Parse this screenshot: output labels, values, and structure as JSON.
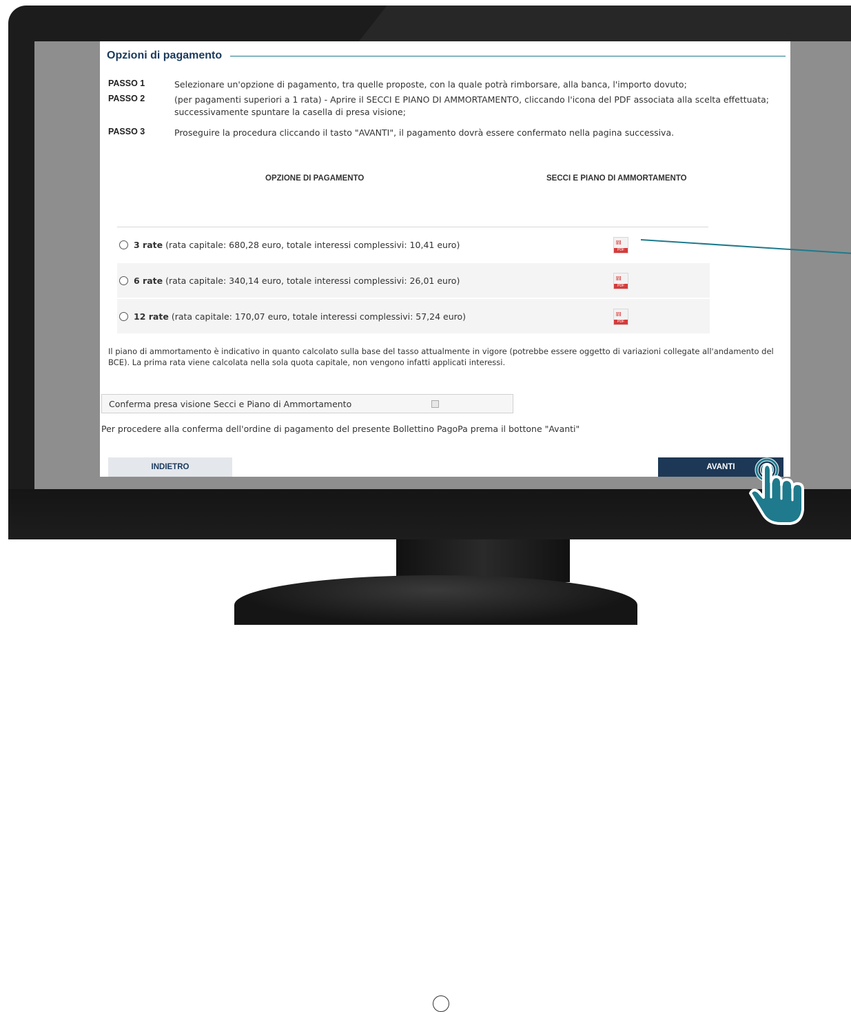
{
  "window": {
    "title": "Opzioni di pagamento"
  },
  "steps": [
    {
      "label": "PASSO 1",
      "text": "Selezionare un'opzione di pagamento, tra quelle proposte, con la quale potrà rimborsare, alla banca, l'importo dovuto;"
    },
    {
      "label": "PASSO 2",
      "text": "(per pagamenti superiori a 1 rata) - Aprire il SECCI E PIANO DI AMMORTAMENTO, cliccando l'icona del PDF associata alla scelta effettuata; successivamente spuntare la casella di presa visione;"
    },
    {
      "label": "PASSO 3",
      "text": "Proseguire la procedura cliccando il tasto \"AVANTI\", il pagamento dovrà essere confermato nella pagina successiva."
    }
  ],
  "table": {
    "col_option": "OPZIONE DI PAGAMENTO",
    "col_secci": "SECCI E PIANO DI AMMORTAMENTO",
    "pdf_tag": "PDF",
    "options": [
      {
        "rate": "3 rate",
        "detail": "(rata capitale: 680,28  euro, totale interessi complessivi: 10,41  euro)"
      },
      {
        "rate": "6 rate",
        "detail": "(rata capitale: 340,14  euro, totale interessi complessivi: 26,01  euro)"
      },
      {
        "rate": "12 rate",
        "detail": "(rata capitale: 170,07  euro, totale interessi complessivi: 57,24  euro)"
      }
    ]
  },
  "note": "Il piano di ammortamento è indicativo in quanto calcolato sulla base del tasso attualmente in vigore (potrebbe essere oggetto di variazioni collegate all'andamento del BCE). La prima rata viene calcolata nella sola quota capitale, non vengono infatti applicati interessi.",
  "confirm_label": "Conferma presa visione Secci e Piano di Ammortamento",
  "procedi_text": "Per procedere alla conferma dell'ordine di pagamento del presente Bollettino PagoPa  prema il bottone \"Avanti\"",
  "buttons": {
    "back": "INDIETRO",
    "next": "AVANTI"
  },
  "colors": {
    "accent": "#1e7a8c",
    "heading": "#1a3a5c",
    "next_button": "#1d3856",
    "pdf_red": "#d63b3b"
  }
}
